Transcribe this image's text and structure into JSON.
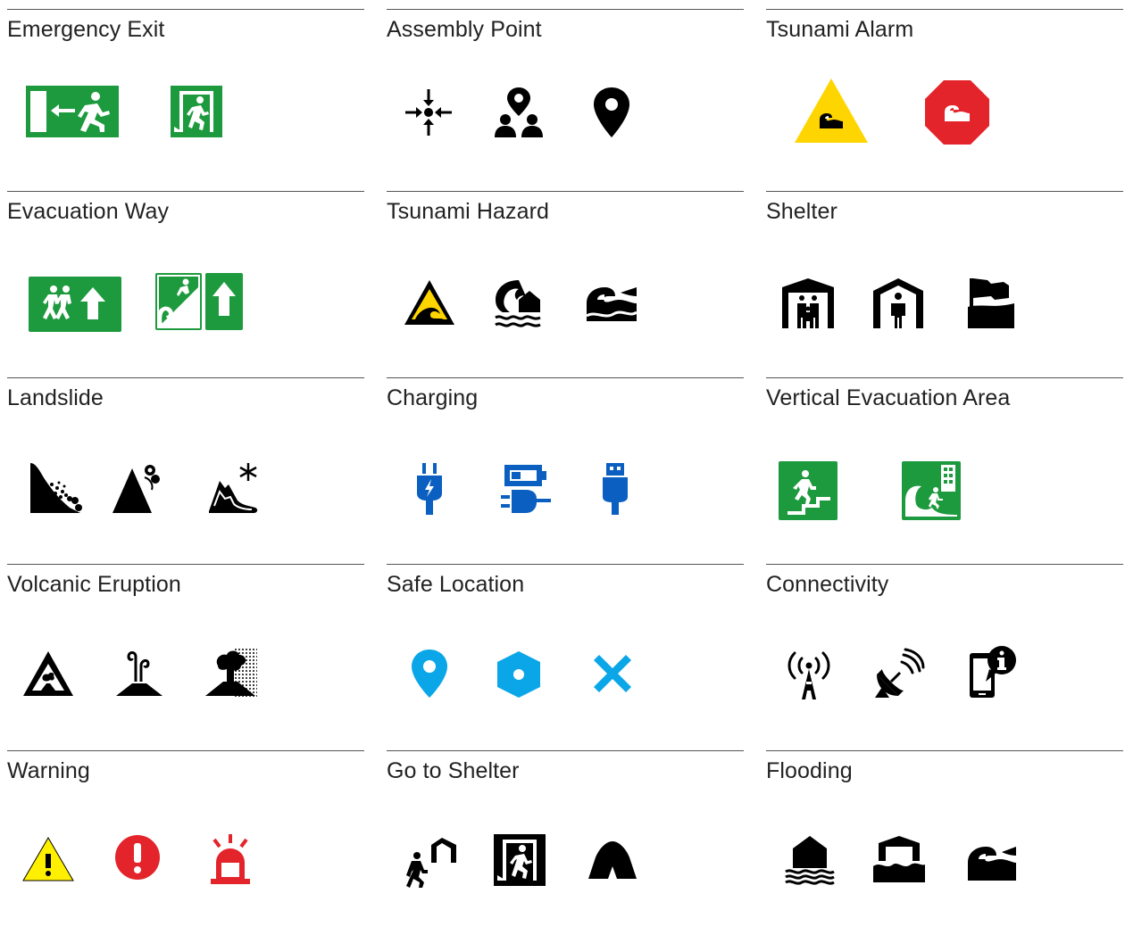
{
  "colors": {
    "exit_green": "#1e9a3e",
    "alarm_yellow": "#ffd500",
    "alarm_red": "#e3242b",
    "charging_blue": "#0a5fc0",
    "safe_cyan": "#0aa6e8",
    "warning_yellow": "#fff000",
    "black": "#000000",
    "rule": "#555555"
  },
  "categories": [
    {
      "title": "Emergency Exit",
      "icons": [
        "exit-left-sign-icon",
        "exit-door-sign-icon"
      ]
    },
    {
      "title": "Assembly Point",
      "icons": [
        "assembly-arrows-icon",
        "assembly-people-pin-icon",
        "location-pin-icon"
      ]
    },
    {
      "title": "Tsunami Alarm",
      "icons": [
        "tsunami-alarm-triangle-icon",
        "tsunami-alarm-octagon-icon"
      ]
    },
    {
      "title": "Evacuation Way",
      "icons": [
        "evacuation-people-arrow-icon",
        "evacuation-uphill-arrow-icon"
      ]
    },
    {
      "title": "Tsunami Hazard",
      "icons": [
        "tsunami-hazard-triangle-icon",
        "tsunami-wave-house-icon",
        "tsunami-wave-icon"
      ]
    },
    {
      "title": "Shelter",
      "icons": [
        "shelter-family-icon",
        "shelter-person-icon",
        "shelter-flag-icon"
      ]
    },
    {
      "title": "Landslide",
      "icons": [
        "landslide-slope-icon",
        "landslide-mountain-icon",
        "landslide-snow-icon"
      ]
    },
    {
      "title": "Charging",
      "icons": [
        "charging-plug-icon",
        "charging-battery-plug-icon",
        "charging-usb-icon"
      ]
    },
    {
      "title": "Vertical Evacuation Area",
      "icons": [
        "vertical-evacuation-stairs-icon",
        "vertical-evacuation-building-icon"
      ]
    },
    {
      "title": "Volcanic Eruption",
      "icons": [
        "volcano-triangle-icon",
        "volcano-steam-icon",
        "volcano-ash-icon"
      ]
    },
    {
      "title": "Safe Location",
      "icons": [
        "safe-pin-icon",
        "safe-hexagon-icon",
        "safe-x-icon"
      ]
    },
    {
      "title": "Connectivity",
      "icons": [
        "antenna-signal-icon",
        "satellite-dish-icon",
        "phone-info-icon"
      ]
    },
    {
      "title": "Warning",
      "icons": [
        "warning-triangle-icon",
        "alert-circle-icon",
        "siren-icon"
      ]
    },
    {
      "title": "Go to Shelter",
      "icons": [
        "run-to-shelter-icon",
        "exit-door-runner-icon",
        "tent-icon"
      ]
    },
    {
      "title": "Flooding",
      "icons": [
        "flood-house-icon",
        "flood-building-icon",
        "flood-wave-icon"
      ]
    }
  ]
}
